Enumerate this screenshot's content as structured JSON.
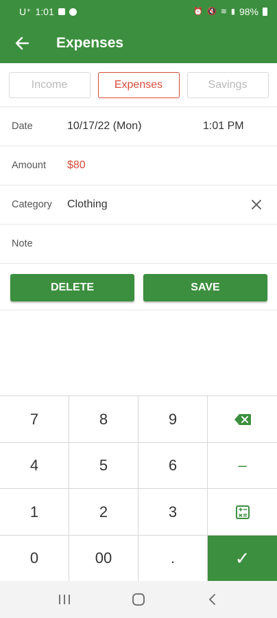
{
  "status_bar": {
    "carrier": "U⁺",
    "time": "1:01",
    "battery": "98%"
  },
  "app_bar": {
    "title": "Expenses"
  },
  "tabs": [
    {
      "label": "Income",
      "active": false
    },
    {
      "label": "Expenses",
      "active": true
    },
    {
      "label": "Savings",
      "active": false
    }
  ],
  "form": {
    "date": {
      "label": "Date",
      "value": "10/17/22 (Mon)",
      "time": "1:01 PM"
    },
    "amount": {
      "label": "Amount",
      "value": "$80"
    },
    "category": {
      "label": "Category",
      "value": "Clothing"
    },
    "note": {
      "label": "Note",
      "value": ""
    }
  },
  "actions": {
    "delete_label": "DELETE",
    "save_label": "SAVE"
  },
  "keypad": {
    "k7": "7",
    "k8": "8",
    "k9": "9",
    "k4": "4",
    "k5": "5",
    "k6": "6",
    "k1": "1",
    "k2": "2",
    "k3": "3",
    "k0": "0",
    "k00": "00",
    "kdot": ".",
    "minus": "–",
    "confirm": "✓"
  },
  "icons": {
    "backspace": "backspace-icon",
    "calculator": "calculator-icon"
  },
  "colors": {
    "primary": "#3c8f3e",
    "accent": "#d84a3a"
  }
}
